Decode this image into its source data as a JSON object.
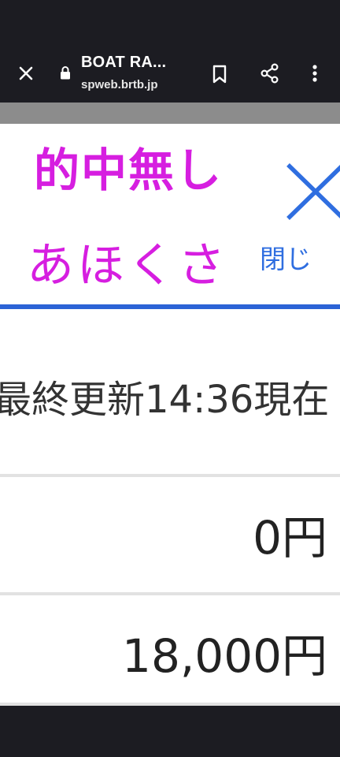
{
  "browser": {
    "title": "BOAT RA...",
    "url": "spweb.brtb.jp"
  },
  "page": {
    "headline": "的中無し",
    "subline": "あほくさ",
    "close_label": "閉じ",
    "updated": "最終更新14:36現在",
    "value_1": "0円",
    "value_2": "18,000円"
  },
  "colors": {
    "headline": "#d61ee0",
    "accent": "#2c63d6",
    "chrome": "#1c1c22"
  },
  "icons": [
    "close-icon",
    "lock-icon",
    "bookmark-icon",
    "share-icon",
    "more-icon",
    "big-x-icon"
  ]
}
